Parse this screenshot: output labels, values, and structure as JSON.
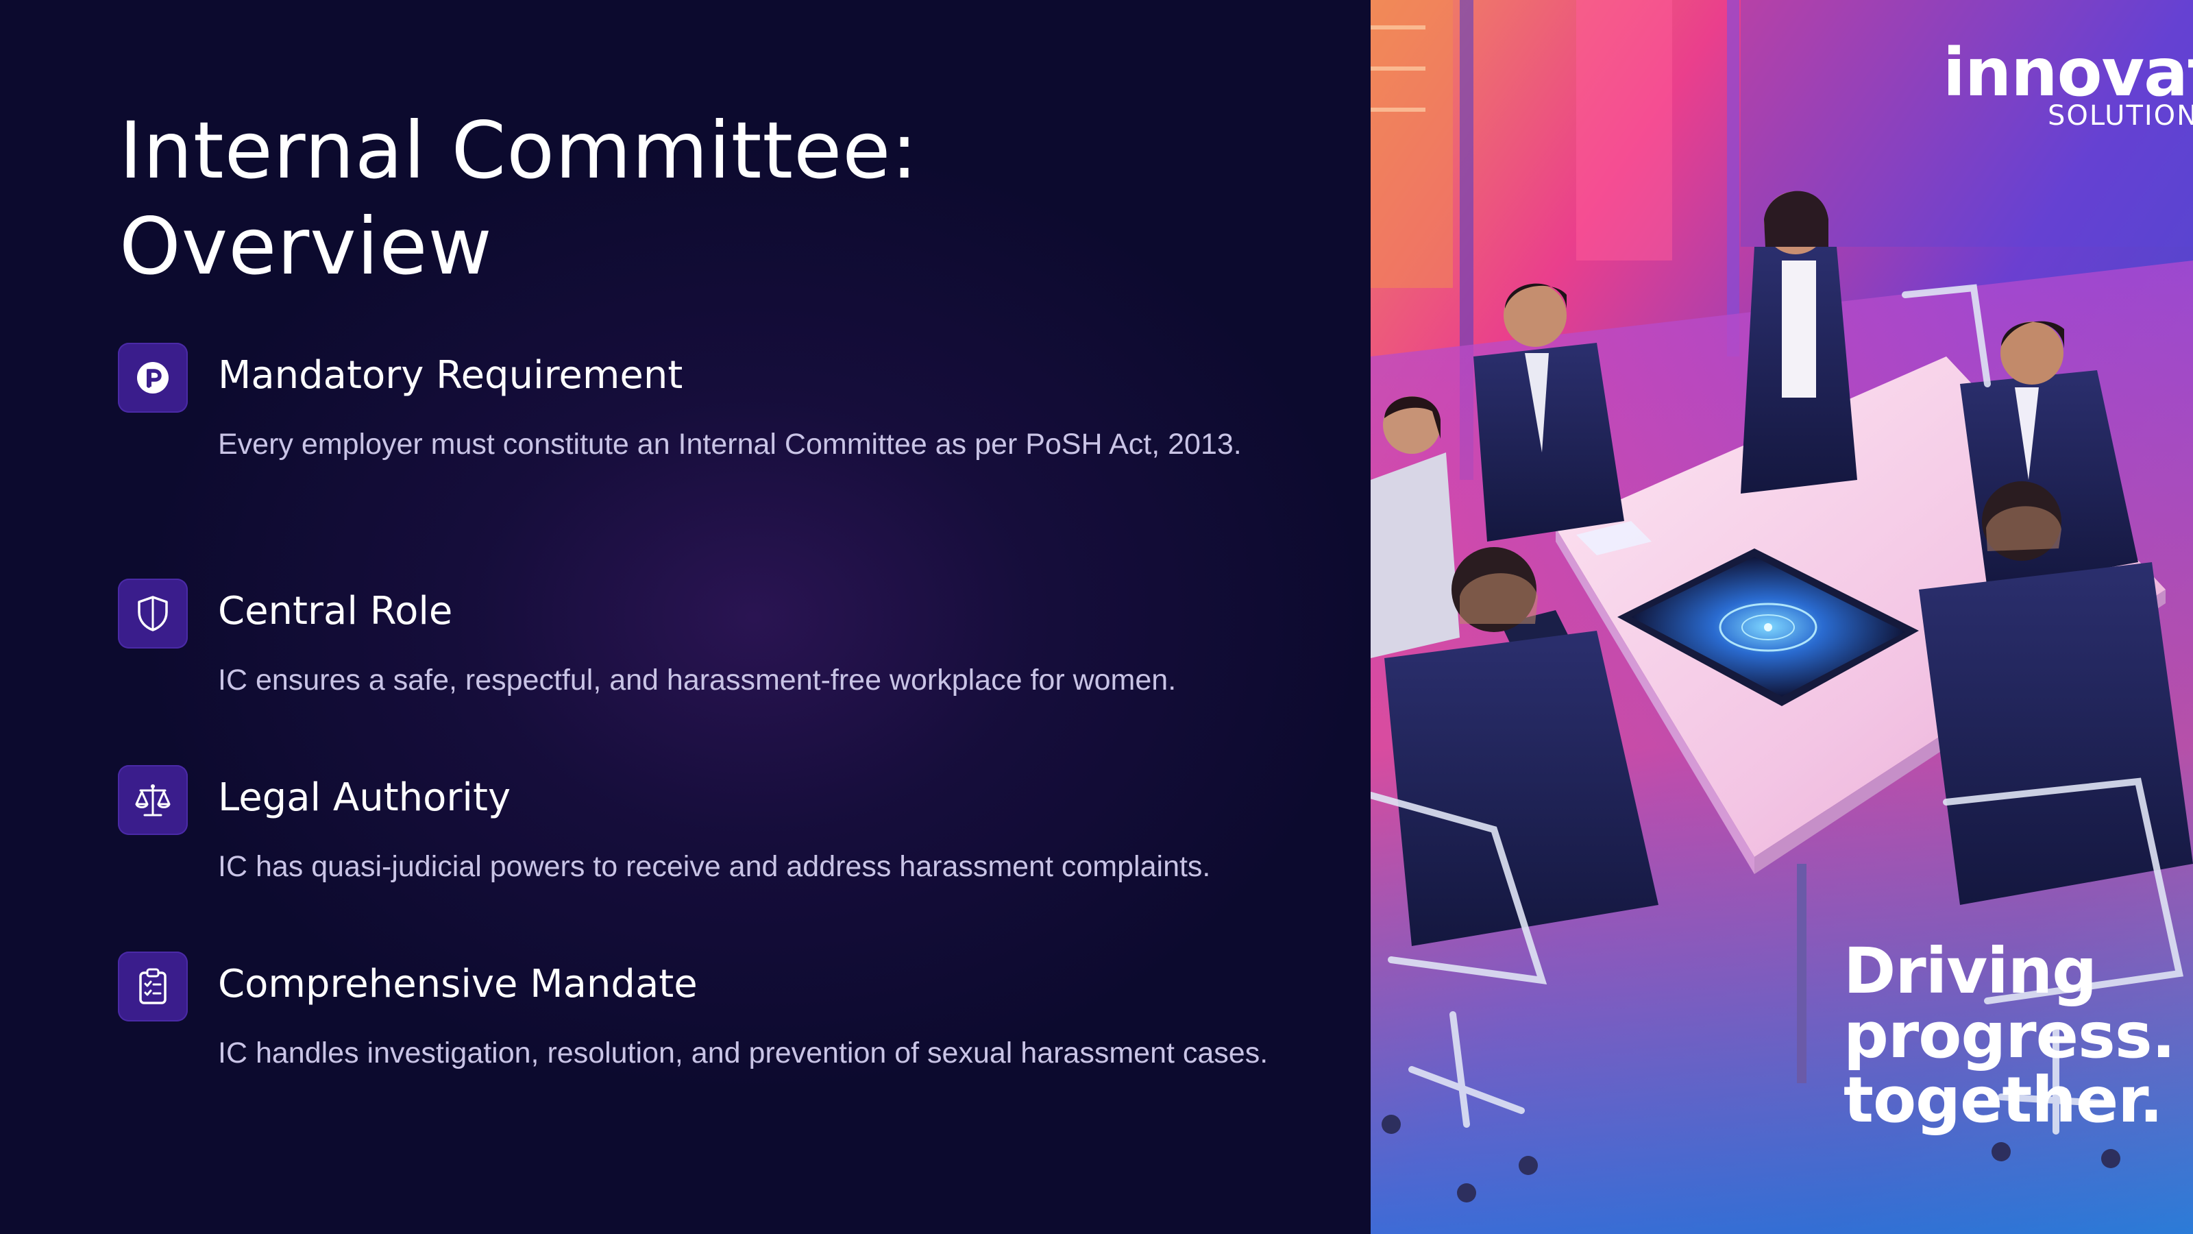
{
  "slide": {
    "title_line1": "Internal Committee:",
    "title_line2": "Overview"
  },
  "items": [
    {
      "icon": "r-circle-icon",
      "title": "Mandatory Requirement",
      "description": "Every employer must constitute an Internal Committee as per PoSH Act, 2013."
    },
    {
      "icon": "shield-icon",
      "title": "Central Role",
      "description": "IC ensures a safe, respectful, and harassment-free workplace for women."
    },
    {
      "icon": "scales-icon",
      "title": "Legal Authority",
      "description": "IC has quasi-judicial powers to receive and address harassment complaints."
    },
    {
      "icon": "clipboard-checklist-icon",
      "title": "Comprehensive Mandate",
      "description": "IC handles investigation, resolution, and prevention of sexual harassment cases."
    }
  ],
  "brand": {
    "name": "innovate",
    "sub": "SOLUTIONS",
    "tagline_line1": "Driving",
    "tagline_line2": "progress.",
    "tagline_line3": "together."
  },
  "colors": {
    "background": "#0c0a2e",
    "icon_box": "#3a1d8c",
    "title_text": "#ffffff",
    "body_text": "#c9c4e6"
  }
}
